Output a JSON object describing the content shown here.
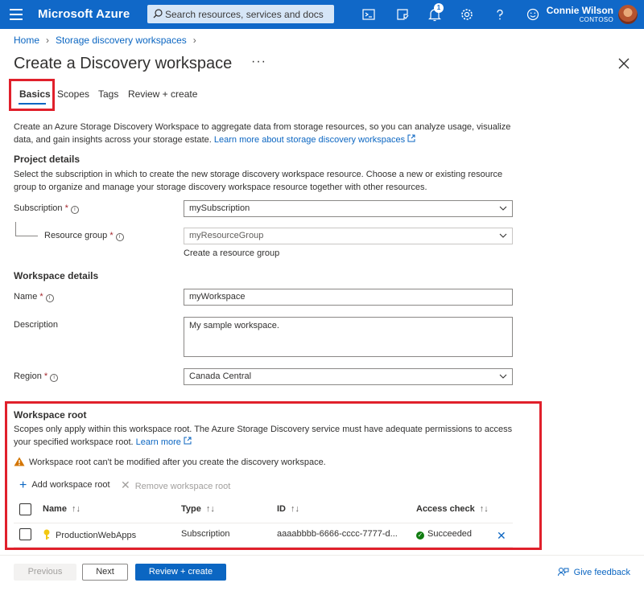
{
  "topbar": {
    "brand": "Microsoft Azure",
    "search_placeholder": "Search resources, services and docs",
    "notifications_count": "1",
    "user_name": "Connie Wilson",
    "user_org": "CONTOSO",
    "accent": "#1068c8"
  },
  "breadcrumb": [
    "Home",
    "Storage discovery workspaces"
  ],
  "page_title": "Create a Discovery workspace",
  "more_label": "···",
  "tabs": [
    {
      "label": "Basics",
      "active": true
    },
    {
      "label": "Scopes"
    },
    {
      "label": "Tags"
    },
    {
      "label": "Review + create"
    }
  ],
  "intro": {
    "text": "Create an Azure Storage Discovery Workspace to aggregate data from storage resources, so you can analyze usage, visualize data, and gain insights across your storage estate.",
    "link": "Learn more about storage discovery workspaces"
  },
  "project": {
    "heading": "Project details",
    "text": "Select the subscription in which to create the new storage discovery workspace resource. Choose a new or existing resource group to organize and manage your storage discovery workspace resource together with other resources.",
    "subscription_label": "Subscription",
    "subscription_value": "mySubscription",
    "rg_label": "Resource group",
    "rg_value": "myResourceGroup",
    "rg_create_link": "Create a resource group"
  },
  "workspace": {
    "heading": "Workspace details",
    "name_label": "Name",
    "name_value": "myWorkspace",
    "desc_label": "Description",
    "desc_value": "My sample workspace.",
    "region_label": "Region",
    "region_value": "Canada Central"
  },
  "root": {
    "heading": "Workspace root",
    "text": "Scopes only apply within this workspace root. The Azure Storage Discovery service must have adequate permissions to access your specified workspace root.",
    "link": "Learn more",
    "warning": "Workspace root can't be modified after you create the discovery workspace.",
    "add_label": "Add workspace root",
    "remove_label": "Remove workspace root",
    "columns": [
      "Name",
      "Type",
      "ID",
      "Access check"
    ],
    "rows": [
      {
        "name": "ProductionWebApps",
        "type": "Subscription",
        "id": "aaaabbbb-6666-cccc-7777-d...",
        "access": "Succeeded"
      }
    ]
  },
  "footer": {
    "previous": "Previous",
    "next": "Next",
    "review": "Review + create",
    "feedback": "Give feedback"
  },
  "required_mark": "*",
  "sort_glyph": "↑↓",
  "info_glyph": "i"
}
